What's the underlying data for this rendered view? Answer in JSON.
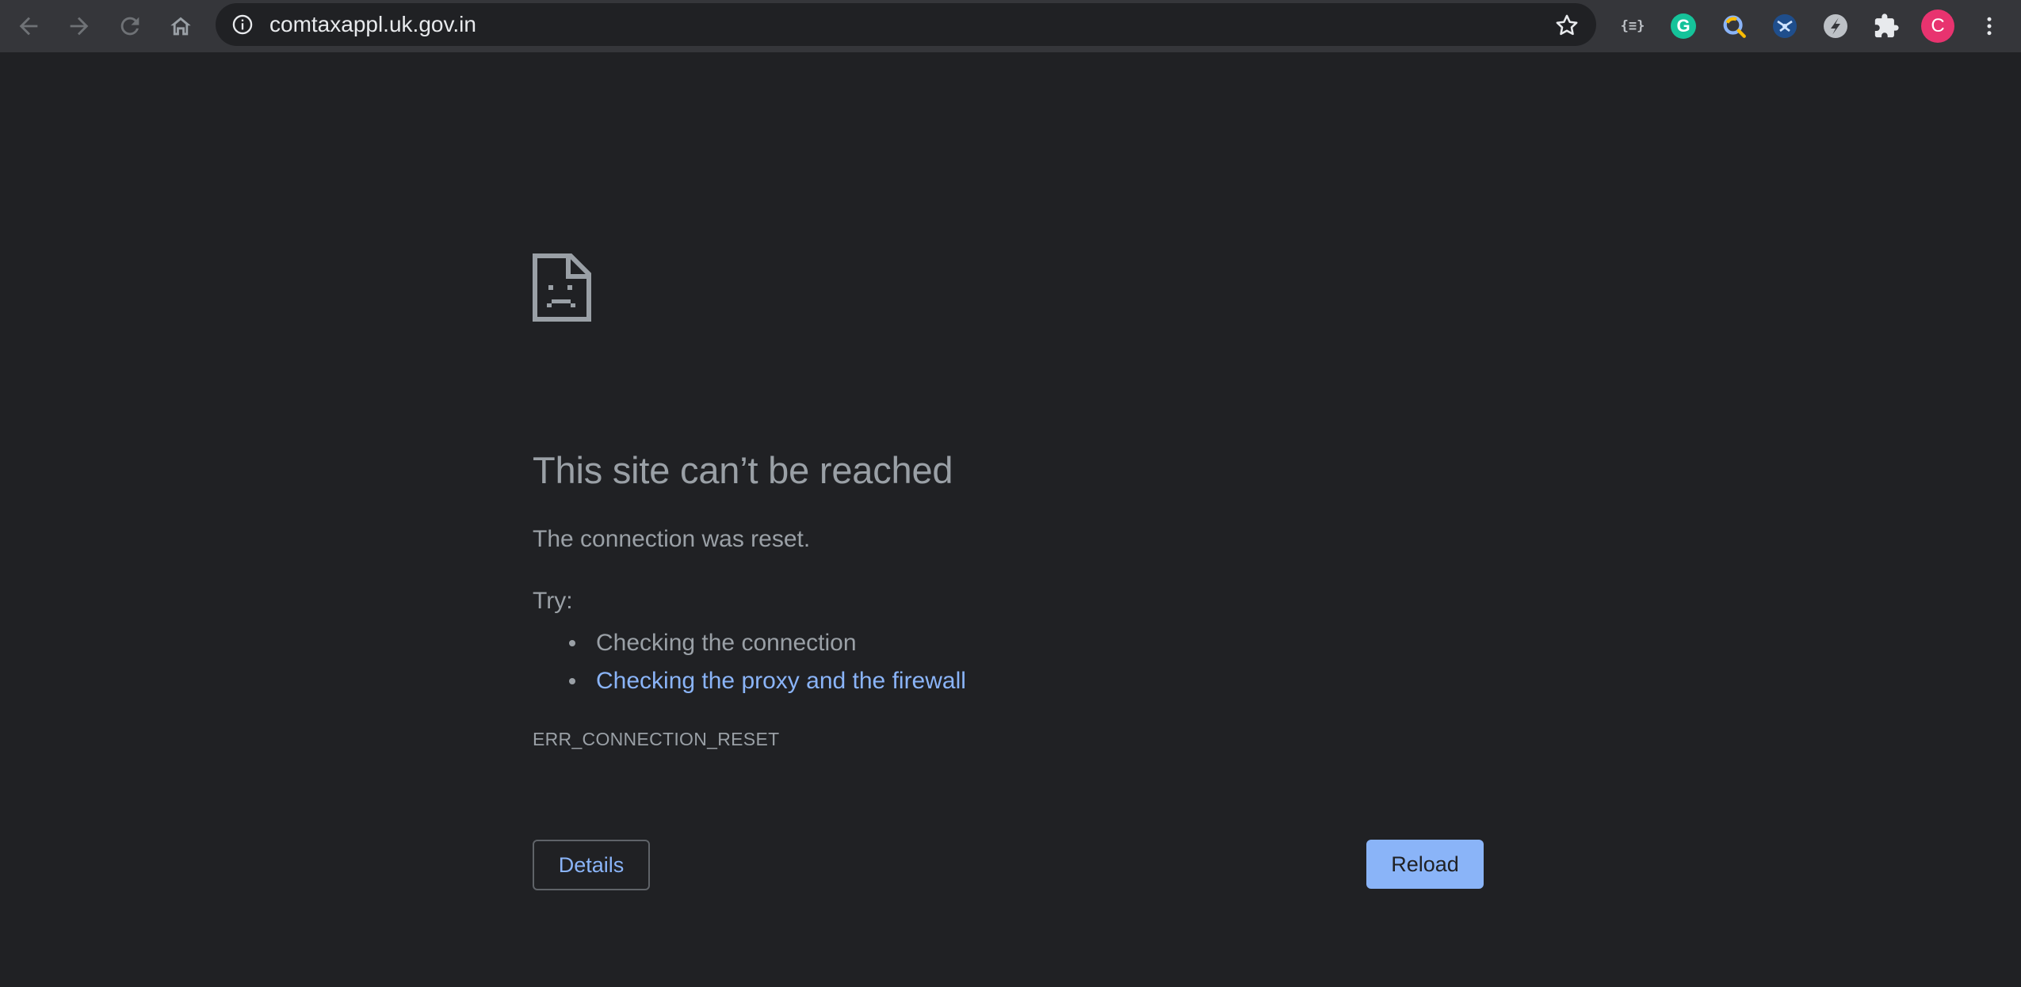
{
  "browser": {
    "url": "comtaxappl.uk.gov.in",
    "nav_icons": [
      "back-icon",
      "forward-icon",
      "reload-icon",
      "home-icon"
    ],
    "extensions": [
      {
        "name": "json-viewer-extension-icon",
        "label": "{≡}"
      },
      {
        "name": "grammarly-extension-icon",
        "label": "G"
      },
      {
        "name": "search-extension-icon"
      },
      {
        "name": "proxy-extension-icon"
      },
      {
        "name": "speed-extension-icon"
      },
      {
        "name": "puzzle-extensions-icon"
      }
    ],
    "profile_initial": "C",
    "colors": {
      "toolbar": "#35363a",
      "page_bg": "#202124",
      "link": "#8ab4f8",
      "avatar": "#e8336f"
    }
  },
  "error": {
    "headline": "This site can’t be reached",
    "message": "The connection was reset.",
    "try_label": "Try:",
    "suggestions": [
      {
        "text": "Checking the connection",
        "is_link": false
      },
      {
        "text": "Checking the proxy and the firewall",
        "is_link": true
      }
    ],
    "code": "ERR_CONNECTION_RESET",
    "details_label": "Details",
    "reload_label": "Reload"
  }
}
